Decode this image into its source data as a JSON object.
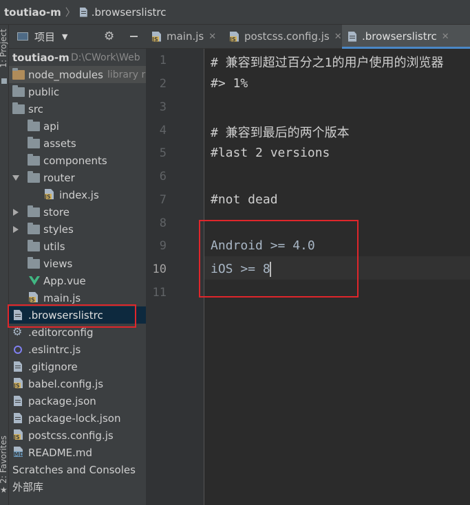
{
  "breadcrumb": {
    "project": "toutiao-m",
    "file": ".browserslistrc"
  },
  "side_stripe": {
    "project_tab": "1: Project",
    "favorites_tab": "2: Favorites"
  },
  "project_panel": {
    "title": "项目",
    "root": {
      "name": "toutiao-m",
      "path": "D:\\CWork\\Web"
    },
    "items": [
      {
        "name": "node_modules",
        "hint": "library r"
      },
      {
        "name": "public"
      },
      {
        "name": "src"
      },
      {
        "name": "api"
      },
      {
        "name": "assets"
      },
      {
        "name": "components"
      },
      {
        "name": "router"
      },
      {
        "name": "index.js"
      },
      {
        "name": "store"
      },
      {
        "name": "styles"
      },
      {
        "name": "utils"
      },
      {
        "name": "views"
      },
      {
        "name": "App.vue"
      },
      {
        "name": "main.js"
      },
      {
        "name": ".browserslistrc"
      },
      {
        "name": ".editorconfig"
      },
      {
        "name": ".eslintrc.js"
      },
      {
        "name": ".gitignore"
      },
      {
        "name": "babel.config.js"
      },
      {
        "name": "package.json"
      },
      {
        "name": "package-lock.json"
      },
      {
        "name": "postcss.config.js"
      },
      {
        "name": "README.md"
      },
      {
        "name": "Scratches and Consoles"
      },
      {
        "name": "外部库"
      }
    ]
  },
  "tabs": [
    {
      "label": "main.js",
      "icon": "js-file-icon",
      "active": false
    },
    {
      "label": "postcss.config.js",
      "icon": "js-file-icon",
      "active": false
    },
    {
      "label": ".browserslistrc",
      "icon": "text-file-icon",
      "active": true
    }
  ],
  "editor": {
    "current_line": 10,
    "lines": [
      {
        "n": "1",
        "text": "# 兼容到超过百分之1的用户使用的浏览器"
      },
      {
        "n": "2",
        "text": "#> 1%"
      },
      {
        "n": "3",
        "text": ""
      },
      {
        "n": "4",
        "text": "# 兼容到最后的两个版本"
      },
      {
        "n": "5",
        "text": "#last 2 versions"
      },
      {
        "n": "6",
        "text": ""
      },
      {
        "n": "7",
        "text": "#not dead"
      },
      {
        "n": "8",
        "text": ""
      },
      {
        "n": "9",
        "text": "Android >= 4.0"
      },
      {
        "n": "10",
        "text": "iOS >= 8"
      },
      {
        "n": "11",
        "text": ""
      }
    ]
  },
  "colors": {
    "highlight_box": "#e0262b",
    "selection": "#0d293e",
    "accent_tab": "#4a88c7"
  }
}
